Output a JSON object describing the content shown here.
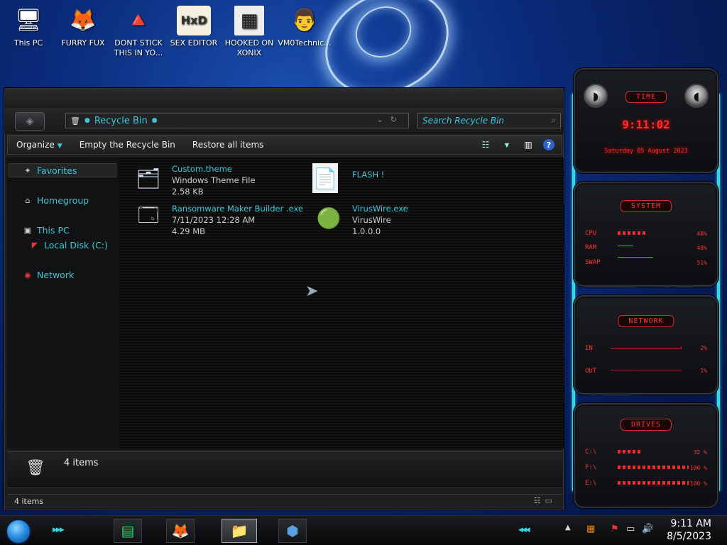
{
  "desktop": {
    "icons": [
      {
        "label": "This PC",
        "glyph": "🖥"
      },
      {
        "label": "FURRY FUX",
        "glyph": "🦊"
      },
      {
        "label": "DONT STICK THIS IN YO...",
        "glyph": "🔺"
      },
      {
        "label": "SEX EDITOR",
        "glyph": "HxD"
      },
      {
        "label": "HOOKED ON XONIX",
        "glyph": "▦"
      },
      {
        "label": "VM0Technic...",
        "glyph": "👨"
      }
    ]
  },
  "explorer": {
    "location": "Recycle Bin",
    "search_placeholder": "Search Recycle Bin",
    "toolbar": {
      "organize": "Organize",
      "empty": "Empty the Recycle Bin",
      "restore": "Restore all items"
    },
    "nav": {
      "favorites": "Favorites",
      "homegroup": "Homegroup",
      "thispc": "This PC",
      "localdisk": "Local Disk (C:)",
      "network": "Network"
    },
    "files": [
      {
        "name": "Custom.theme",
        "line2": "Windows Theme File",
        "line3": "2.58 KB",
        "glyph": "🗂"
      },
      {
        "name": "FLASH !",
        "line2": "",
        "line3": "",
        "glyph": "📄"
      },
      {
        "name": "Ransomware Maker Builder .exe",
        "line2": "7/11/2023 12:28 AM",
        "line3": "4.29 MB",
        "glyph": "🗔"
      },
      {
        "name": "VirusWire.exe",
        "line2": "VirusWire",
        "line3": "1.0.0.0",
        "glyph": "🟢"
      }
    ],
    "details_count": "4 items",
    "status_count": "4 items"
  },
  "gadget": {
    "time": {
      "title": "TIME",
      "clock": "9:11:02",
      "date": "Saturday 05 August 2023"
    },
    "system": {
      "title": "SYSTEM",
      "cpu_label": "CPU",
      "cpu_val": "48%",
      "ram_label": "RAM",
      "ram_val": "48%",
      "swap_label": "SWAP",
      "swap_val": "51%",
      "cpu_fill": 0.5
    },
    "network": {
      "title": "NETWORK",
      "in_label": "IN",
      "in_val": "2%",
      "out_label": "OUT",
      "out_val": "1%"
    },
    "drives": {
      "title": "DRIVES",
      "items": [
        {
          "label": "C:\\",
          "val": "32 %",
          "fill": 0.32
        },
        {
          "label": "F:\\",
          "val": "100 %",
          "fill": 1.0
        },
        {
          "label": "E:\\",
          "val": "100 %",
          "fill": 1.0
        }
      ]
    }
  },
  "taskbar": {
    "time": "9:11 AM",
    "date": "8/5/2023"
  },
  "colors": {
    "accent": "#3fc6d8",
    "gadget_red": "#ff3434"
  }
}
